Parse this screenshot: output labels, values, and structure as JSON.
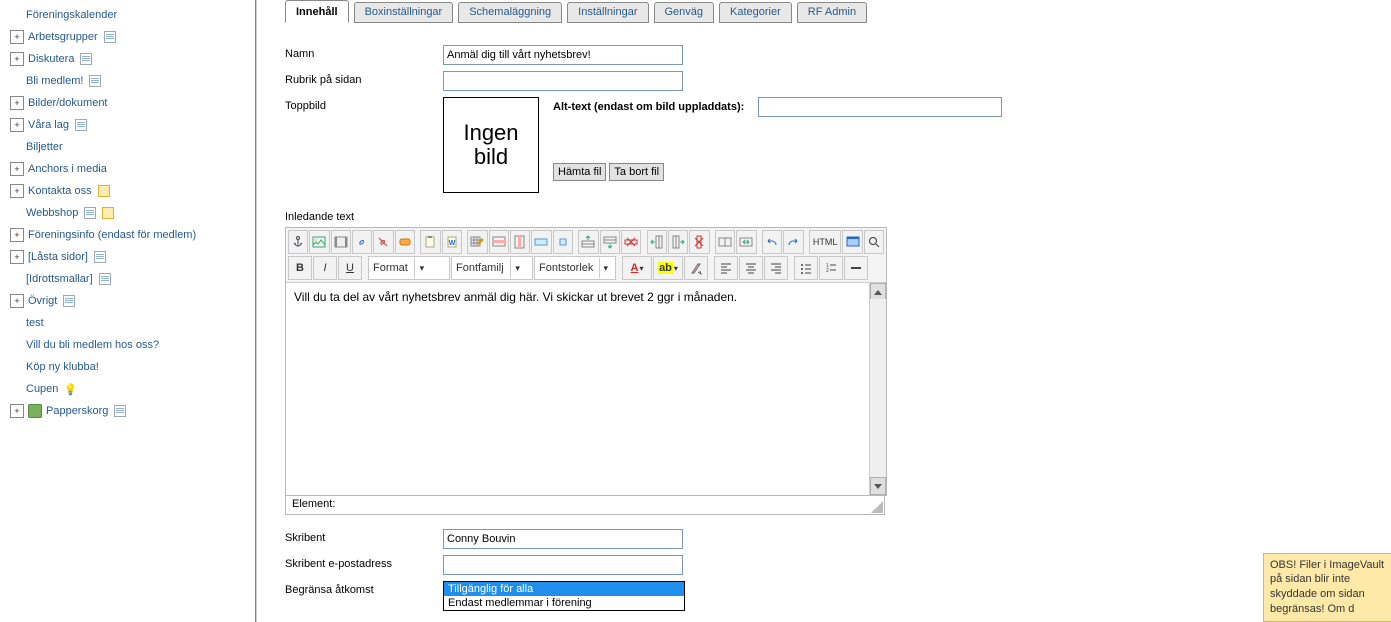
{
  "sidebar": {
    "items": [
      {
        "label": "Föreningskalender",
        "expand": "",
        "icon": ""
      },
      {
        "label": "Arbetsgrupper",
        "expand": "+",
        "icon": "page"
      },
      {
        "label": "Diskutera",
        "expand": "+",
        "icon": "page"
      },
      {
        "label": "Bli medlem!",
        "expand": "",
        "icon": "page"
      },
      {
        "label": "Bilder/dokument",
        "expand": "+",
        "icon": ""
      },
      {
        "label": "Våra lag",
        "expand": "+",
        "icon": "page"
      },
      {
        "label": "Biljetter",
        "expand": "",
        "icon": ""
      },
      {
        "label": "Anchors i media",
        "expand": "+",
        "icon": ""
      },
      {
        "label": "Kontakta oss",
        "expand": "+",
        "icon": "exclaim"
      },
      {
        "label": "Webbshop",
        "expand": "",
        "icon": "double"
      },
      {
        "label": "Föreningsinfo (endast för medlem)",
        "expand": "+",
        "icon": ""
      },
      {
        "label": "[Låsta sidor]",
        "expand": "+",
        "icon": "page"
      },
      {
        "label": "[Idrottsmallar]",
        "expand": "",
        "icon": "page"
      },
      {
        "label": "Övrigt",
        "expand": "+",
        "icon": "page"
      },
      {
        "label": "test",
        "expand": "",
        "icon": ""
      },
      {
        "label": "Vill du bli medlem hos oss?",
        "expand": "",
        "icon": ""
      },
      {
        "label": "Köp ny klubba!",
        "expand": "",
        "icon": ""
      },
      {
        "label": "Cupen",
        "expand": "",
        "icon": "bulb"
      },
      {
        "label": "Papperskorg",
        "expand": "+",
        "icon": "trash"
      }
    ]
  },
  "tabs": [
    "Innehåll",
    "Boxinställningar",
    "Schemaläggning",
    "Inställningar",
    "Genväg",
    "Kategorier",
    "RF Admin"
  ],
  "form": {
    "name_label": "Namn",
    "name_value": "Anmäl dig till vårt nyhetsbrev!",
    "rubrik_label": "Rubrik på sidan",
    "rubrik_value": "",
    "toppbild_label": "Toppbild",
    "imgbox_text": "Ingen bild",
    "alt_label": "Alt-text (endast om bild uppladdats):",
    "alt_value": "",
    "hamta_btn": "Hämta fil",
    "tabort_btn": "Ta bort fil",
    "inledande_label": "Inledande text",
    "editor_body": "Vill du ta del av vårt nyhetsbrev anmäl dig här. Vi skickar ut brevet 2 ggr i månaden.",
    "element_label": "Element:",
    "skribent_label": "Skribent",
    "skribent_value": "Conny Bouvin",
    "epost_label": "Skribent e-postadress",
    "epost_value": "",
    "access_label": "Begränsa åtkomst",
    "access_options": [
      "Tillgänglig för alla",
      "Endast medlemmar i förening"
    ]
  },
  "toolbar": {
    "format": "Format",
    "fontfamilj": "Fontfamilj",
    "fontstorlek": "Fontstorlek",
    "html": "HTML"
  },
  "warning": "OBS! Filer i ImageVault på sidan blir inte skyddade om sidan begränsas! Om d"
}
